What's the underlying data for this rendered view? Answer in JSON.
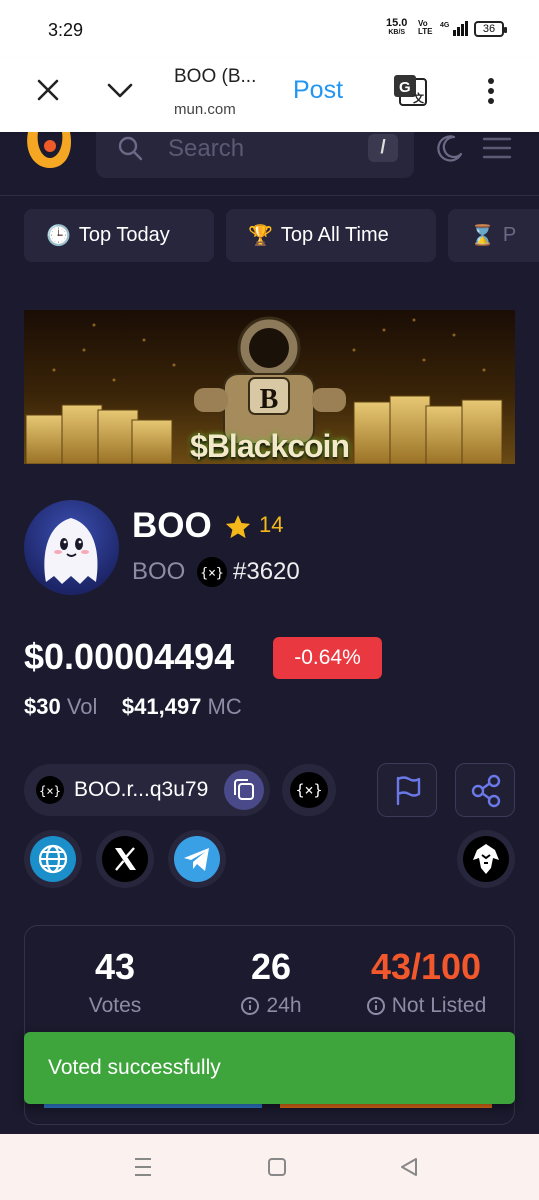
{
  "status_bar": {
    "time": "3:29",
    "net_speed": "15.0",
    "net_unit": "KB/S",
    "network": "4G",
    "battery": "36"
  },
  "browser": {
    "page_title": "BOO (B...",
    "url": "mun.com",
    "post_label": "Post"
  },
  "site": {
    "search_placeholder": "Search",
    "search_shortcut": "/",
    "tabs": [
      {
        "emoji": "🕒",
        "label": "Top Today"
      },
      {
        "emoji": "🏆",
        "label": "Top All Time"
      },
      {
        "emoji": "⌛",
        "label": "P"
      }
    ]
  },
  "banner": {
    "text": "$Blackcoin",
    "badge_letter": "B"
  },
  "token": {
    "name": "BOO",
    "stars": "14",
    "symbol": "BOO",
    "rank": "#3620",
    "price": "$0.00004494",
    "change": "-0.64%",
    "volume": "$30",
    "volume_label": "Vol",
    "market_cap": "$41,497",
    "market_cap_label": "MC",
    "contract": "BOO.r...q3u79"
  },
  "votes": {
    "total": "43",
    "total_label": "Votes",
    "day": "26",
    "day_label": "24h",
    "score": "43/100",
    "score_label": "Not Listed"
  },
  "toast": {
    "message": "Voted successfully"
  },
  "colors": {
    "background": "#1b1a2e",
    "card": "#27263d",
    "accent_blue": "#2196f3",
    "change_red": "#e9383f",
    "star_yellow": "#f5b81a",
    "score_orange": "#f2582c",
    "toast_green": "#3ea53c"
  }
}
